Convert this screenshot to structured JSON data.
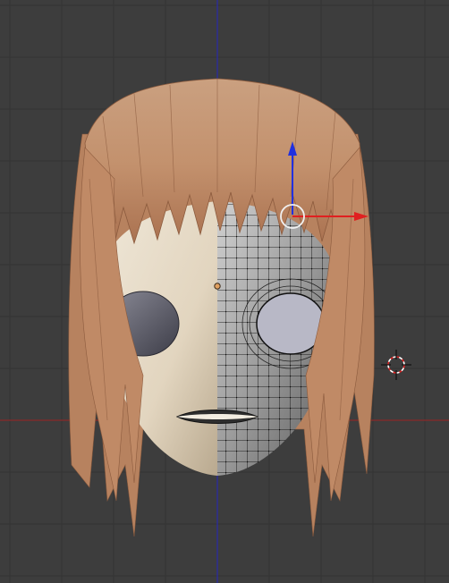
{
  "viewport": {
    "view": "front-ortho",
    "mode": "edit-mode",
    "background_color": "#3d3d3d",
    "grid_color": "#333333",
    "axis_colors": {
      "x_axis_red": "#8a2a2a",
      "z_axis_blue": "#2a2aa8"
    },
    "grid_visible": true
  },
  "model": {
    "object": "anime-head",
    "parts": [
      "hair",
      "face",
      "left-eye-socket",
      "right-eye-socket-wireframe",
      "mouth"
    ],
    "hair_color": "#c99070",
    "skin_color": "#e8dcc8",
    "mesh_wire_color": "#111111"
  },
  "gizmo": {
    "type": "translate",
    "icons": [
      "arrow-z-up-icon",
      "arrow-x-right-icon",
      "gizmo-center-circle-icon"
    ],
    "colors": {
      "x": "#e02020",
      "z": "#2030e0"
    }
  },
  "cursor_3d": {
    "icon": "3d-cursor-icon",
    "color": "#e02020"
  },
  "origin_point": {
    "icon": "object-origin-icon",
    "color": "#e0a060"
  }
}
